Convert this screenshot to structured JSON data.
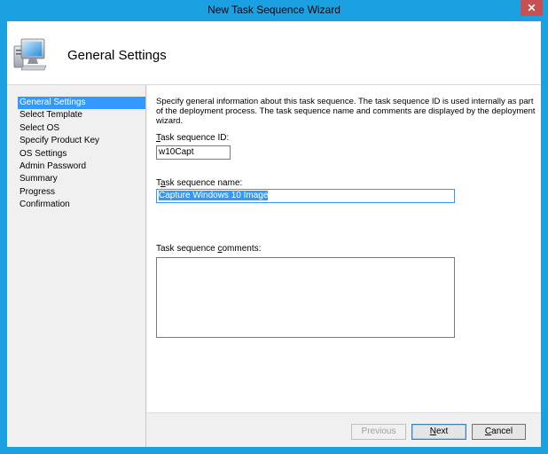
{
  "window": {
    "title": "New Task Sequence Wizard",
    "close_label": "✕"
  },
  "header": {
    "title": "General Settings",
    "icon": "computer-monitor-icon"
  },
  "nav": {
    "items": [
      {
        "label": "General Settings",
        "selected": true
      },
      {
        "label": "Select Template",
        "selected": false
      },
      {
        "label": "Select OS",
        "selected": false
      },
      {
        "label": "Specify Product Key",
        "selected": false
      },
      {
        "label": "OS Settings",
        "selected": false
      },
      {
        "label": "Admin Password",
        "selected": false
      },
      {
        "label": "Summary",
        "selected": false
      },
      {
        "label": "Progress",
        "selected": false
      },
      {
        "label": "Confirmation",
        "selected": false
      }
    ]
  },
  "form": {
    "description": "Specify general information about this task sequence.  The task sequence ID is used internally as part of the deployment process.  The task sequence name and comments are displayed by the deployment wizard.",
    "id_label_pre": "",
    "id_label_key": "T",
    "id_label_post": "ask sequence ID:",
    "id_value": "w10Capt",
    "name_label_pre": "T",
    "name_label_key": "a",
    "name_label_post": "sk sequence name:",
    "name_value": "Capture Windows 10 Image",
    "comments_label_pre": "Task sequence ",
    "comments_label_key": "c",
    "comments_label_post": "omments:",
    "comments_value": ""
  },
  "buttons": {
    "previous_label": "Previous",
    "next_key": "N",
    "next_rest": "ext",
    "cancel_key": "C",
    "cancel_rest": "ancel"
  },
  "colors": {
    "window_frame": "#1ba1e2",
    "selection": "#3399ff",
    "close_button": "#c75050"
  }
}
